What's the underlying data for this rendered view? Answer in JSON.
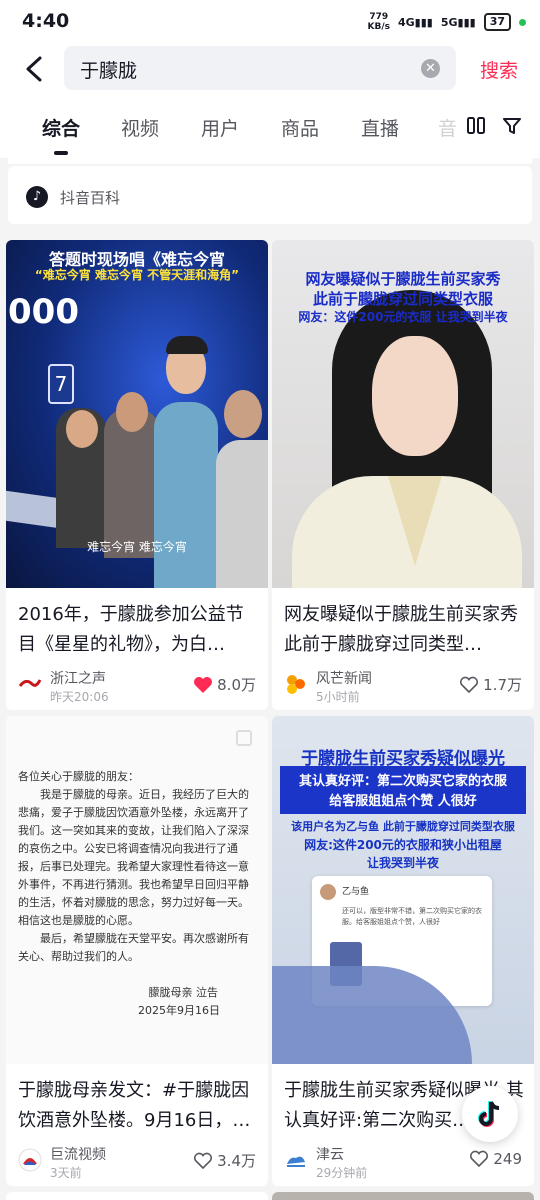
{
  "status_bar": {
    "time": "4:40",
    "speed_value": "779",
    "speed_unit": "KB/s",
    "battery": "37"
  },
  "search": {
    "query": "于朦胧",
    "button_label": "搜索"
  },
  "tabs": [
    "综合",
    "视频",
    "用户",
    "商品",
    "直播",
    "音"
  ],
  "baike": {
    "label": "抖音百科"
  },
  "cards": [
    {
      "title": "2016年，于朦胧参加公益节目《星星的礼物》，为白…",
      "author": "浙江之声",
      "time": "昨天20:06",
      "likes": "8.0万",
      "liked": true,
      "thumb_caption_1": "答题时现场唱《难忘今宵",
      "thumb_caption_2": "“难忘今宵 难忘今宵 不管天涯和海角”",
      "thumb_number": "000",
      "thumb_digit": "7",
      "thumb_subtitle": "难忘今宵 难忘今宵"
    },
    {
      "title": "网友曝疑似于朦胧生前买家秀 此前于朦胧穿过同类型…",
      "author": "风芒新闻",
      "time": "5小时前",
      "likes": "1.7万",
      "liked": false,
      "thumb_caption_1": "网友曝疑似于朦胧生前买家秀",
      "thumb_caption_2": "此前于朦胧穿过同类型衣服",
      "thumb_caption_3": "网友：这件200元的衣服 让我哭到半夜"
    },
    {
      "title": "于朦胧母亲发文：#于朦胧因饮酒意外坠楼。9月16日，…",
      "author": "巨流视频",
      "time": "3天前",
      "likes": "3.4万",
      "liked": false,
      "letter_greeting": "各位关心于朦胧的朋友：",
      "letter_p1": "我是于朦胧的母亲。近日，我经历了巨大的悲痛，爱子于朦胧因饮酒意外坠楼，永远离开了我们。这一突如其来的变故，让我们陷入了深深的哀伤之中。公安已将调查情况向我进行了通报，后事已处理完。我希望大家理性看待这一意外事件，不再进行猜测。我也希望早日回归平静的生活，怀着对朦胧的思念，努力过好每一天。相信这也是朦胧的心愿。",
      "letter_p2": "最后，希望朦胧在天堂平安。再次感谢所有关心、帮助过我们的人。",
      "letter_sign": "朦胧母亲  泣告",
      "letter_date": "2025年9月16日"
    },
    {
      "title": "于朦胧生前买家秀疑似曝光 其认真好评:第二次购买…",
      "author": "津云",
      "time": "29分钟前",
      "likes": "249",
      "liked": false,
      "thumb_caption_1": "于朦胧生前买家秀疑似曝光",
      "thumb_caption_2": "其认真好评：第二次购买它家的衣服",
      "thumb_caption_3": "给客服姐姐点个赞 人很好",
      "thumb_caption_4": "该用户名为乙与鱼 此前于朦胧穿过同类型衣服",
      "thumb_caption_5": "网友:这件200元的衣服和狭小出租屋",
      "thumb_caption_6": "让我哭到半夜",
      "review_user": "乙与鱼",
      "review_text": "还可以，版型非常不错，第二次购买它家的衣服。给客服姐姐点个赞，人很好"
    }
  ],
  "colors": {
    "accent": "#fe2c55",
    "text": "#161823",
    "muted": "#57585f",
    "bg": "#f4f4f4"
  }
}
